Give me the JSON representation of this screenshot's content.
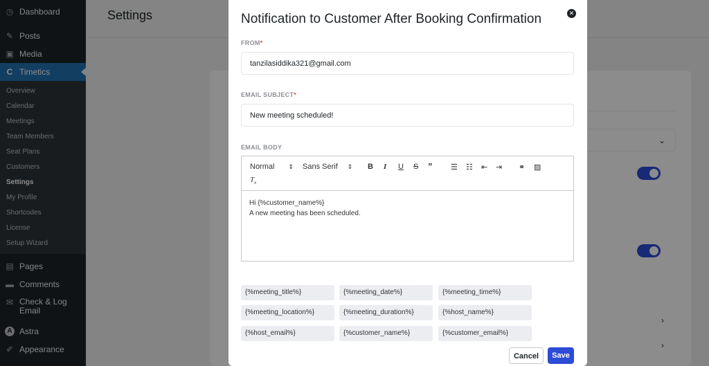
{
  "sidebar": {
    "top_items": [
      {
        "label": "Dashboard",
        "icon": "dashboard-icon",
        "glyph": "◷"
      },
      {
        "label": "Posts",
        "icon": "pin-icon",
        "glyph": "✎"
      },
      {
        "label": "Media",
        "icon": "media-icon",
        "glyph": "▣"
      }
    ],
    "active": {
      "label": "Timetics",
      "icon": "timetics-icon",
      "glyph": "C"
    },
    "sub_items": [
      "Overview",
      "Calendar",
      "Meetings",
      "Team Members",
      "Seat Plans",
      "Customers",
      "Settings",
      "My Profile",
      "Shortcodes",
      "License",
      "Setup Wizard"
    ],
    "current_sub": "Settings",
    "bottom_items": [
      {
        "label": "Pages",
        "icon": "pages-icon",
        "glyph": "▤"
      },
      {
        "label": "Comments",
        "icon": "comments-icon",
        "glyph": "▬"
      },
      {
        "label": "Check & Log Email",
        "icon": "email-icon",
        "glyph": "✉"
      },
      {
        "label": "Astra",
        "icon": "astra-icon",
        "glyph": "A"
      },
      {
        "label": "Appearance",
        "icon": "appearance-icon",
        "glyph": "✐"
      }
    ]
  },
  "page": {
    "title": "Settings"
  },
  "modal": {
    "title": "Notification to Customer After Booking Confirmation",
    "from_label": "FROM",
    "from_value": "tanzilasiddika321@gmail.com",
    "subject_label": "EMAIL SUBJECT",
    "subject_value": "New meeting scheduled!",
    "body_label": "EMAIL BODY",
    "toolbar": {
      "format": "Normal",
      "font": "Sans Serif"
    },
    "body_lines": [
      "Hi {%customer_name%}",
      "A new meeting has been scheduled."
    ],
    "tags": [
      "{%meeting_title%}",
      "{%meeting_date%}",
      "{%meeting_time%}",
      "{%meeting_location%}",
      "{%meeting_duration%}",
      "{%host_name%}",
      "{%host_email%}",
      "{%customer_name%}",
      "{%customer_email%}"
    ],
    "cancel_label": "Cancel",
    "save_label": "Save"
  },
  "colors": {
    "accent": "#2c4bd6",
    "wp_blue": "#2271b1",
    "sidebar": "#1d2327",
    "required": "#e0533d"
  }
}
